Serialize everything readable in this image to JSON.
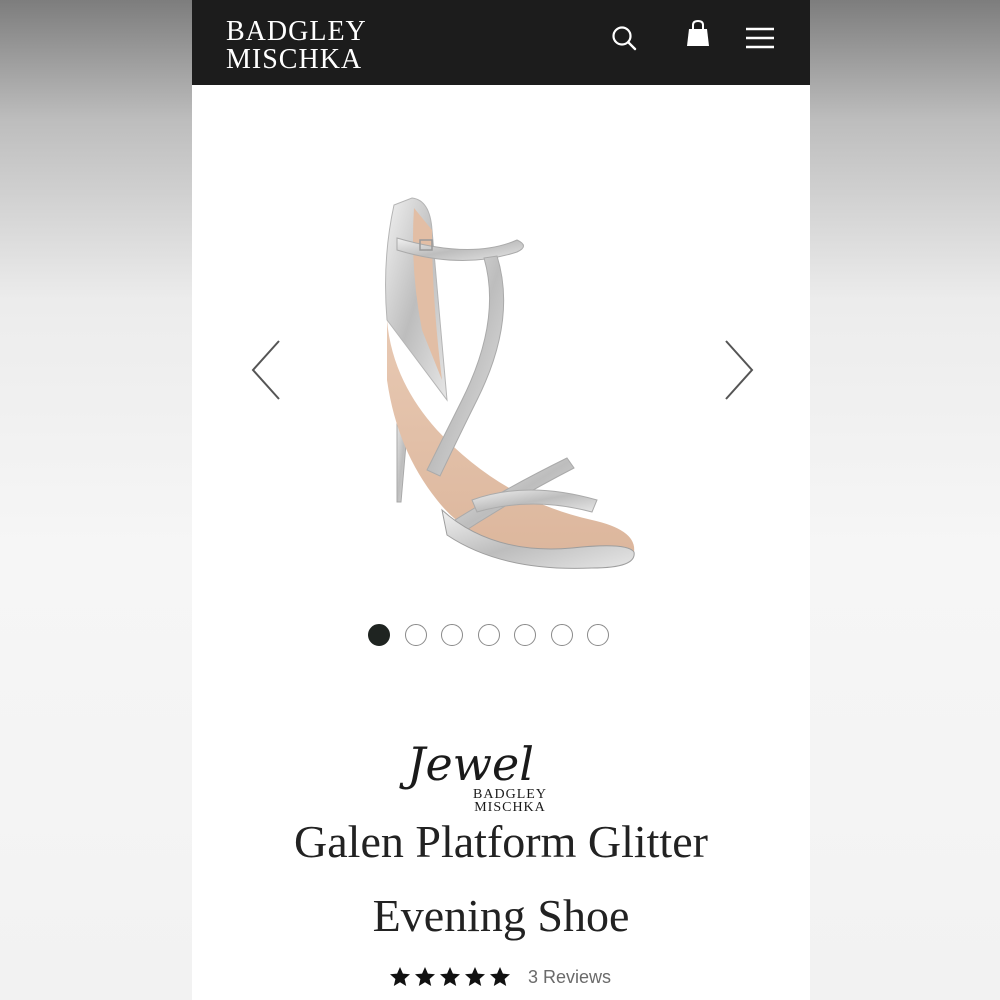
{
  "header": {
    "logo_line1": "BADGLEY",
    "logo_line2": "MISCHKA",
    "icons": [
      "search-icon",
      "shopping-bag-icon",
      "hamburger-menu-icon"
    ]
  },
  "carousel": {
    "image_count": 7,
    "active_index": 0,
    "prev_icon": "chevron-left-icon",
    "next_icon": "chevron-right-icon"
  },
  "product": {
    "brand_script": "Jewel",
    "brand_line1": "BADGLEY",
    "brand_line2": "MISCHKA",
    "title_line1": "Galen Platform Glitter",
    "title_line2": "Evening Shoe",
    "rating": 5,
    "rating_max": 5,
    "reviews_label": "3 Reviews"
  },
  "colors": {
    "header_bg": "#1c1c1c",
    "active_dot": "#1f2421",
    "text": "#222222"
  }
}
